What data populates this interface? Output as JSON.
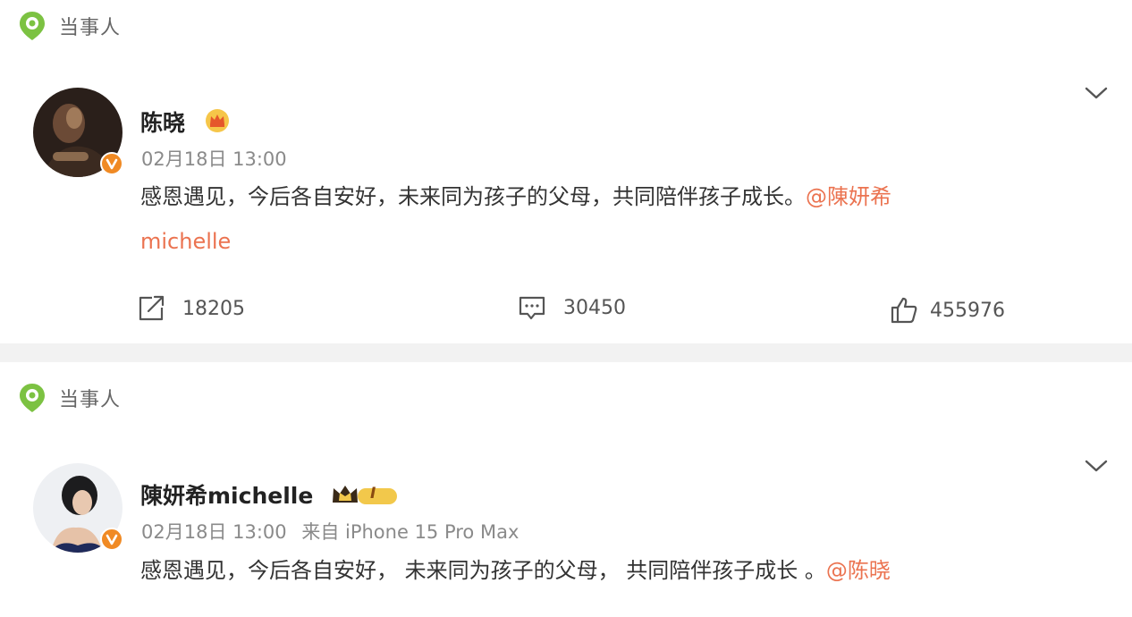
{
  "posts": [
    {
      "tag_label": "当事人",
      "username": "陈晓",
      "timestamp": "02月18日 13:00",
      "text_line1": "感恩遇见，今后各自安好，未来同为孩子的父母，共同陪伴孩子成长。",
      "mention_line1": "@陳妍希",
      "mention_line2": "michelle",
      "actions": {
        "repost_count": "18205",
        "comment_count": "30450",
        "like_count": "455976"
      }
    },
    {
      "tag_label": "当事人",
      "username": "陳妍希michelle",
      "badge_text": "I",
      "timestamp": "02月18日 13:00",
      "source": "来自 iPhone 15 Pro Max",
      "text": "感恩遇见，今后各自安好， 未来同为孩子的父母， 共同陪伴孩子成长 。",
      "mention": "@陈晓"
    }
  ],
  "colors": {
    "mention": "#eb7350",
    "tag_green": "#7cc242",
    "verified": "#f08a24"
  }
}
